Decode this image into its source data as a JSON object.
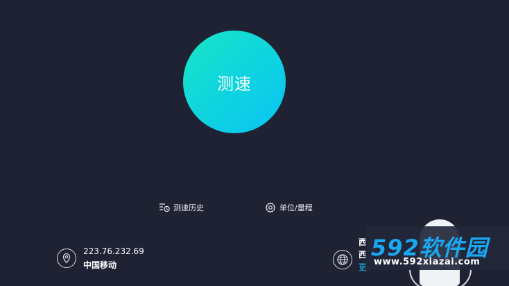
{
  "start_button": {
    "label": "测速"
  },
  "toolbar": {
    "history": {
      "label": "测速历史",
      "icon": "history-list-icon"
    },
    "settings": {
      "label": "单位/量程",
      "icon": "gear-icon"
    }
  },
  "client": {
    "ip": "223.76.232.69",
    "isp": "中国移动",
    "icon": "location-pin-icon"
  },
  "server": {
    "line1": "西",
    "line2": "西",
    "change": "更",
    "icon": "globe-icon"
  },
  "watermark": {
    "title_num": "592",
    "title_cn": "软件园",
    "url": "www.592xiazai.com"
  },
  "colors": {
    "background": "#1e2233",
    "button_gradient_start": "#18e6c4",
    "button_gradient_end": "#08c4f4",
    "link_accent": "#19b8f0"
  }
}
